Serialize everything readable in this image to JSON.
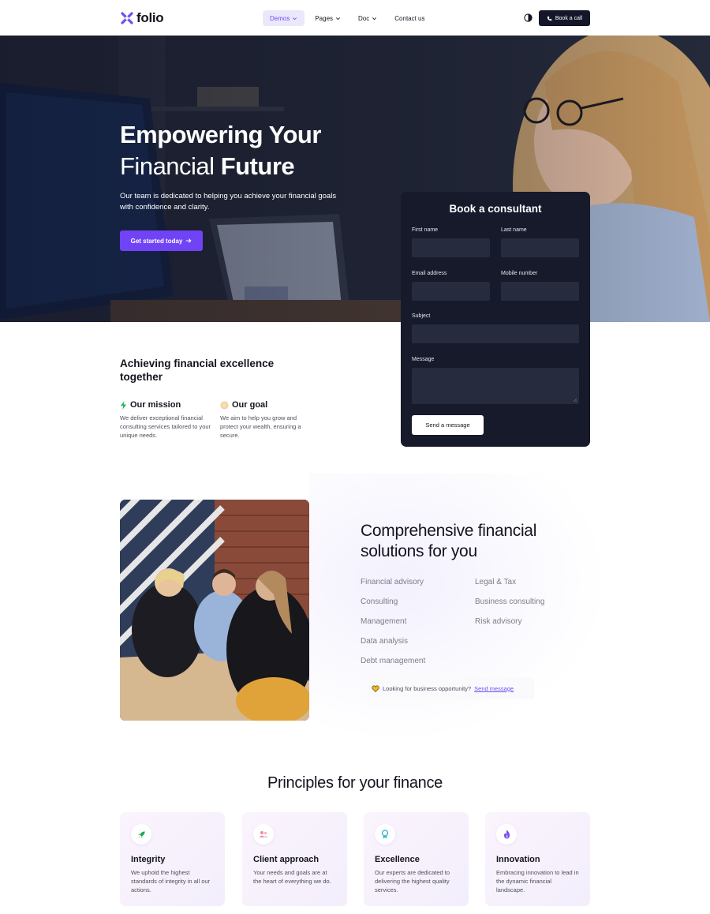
{
  "nav": {
    "brand": "folio",
    "menu": [
      {
        "label": "Demos",
        "active": true,
        "dropdown": true
      },
      {
        "label": "Pages",
        "active": false,
        "dropdown": true
      },
      {
        "label": "Doc",
        "active": false,
        "dropdown": true
      },
      {
        "label": "Contact us",
        "active": false,
        "dropdown": false
      }
    ],
    "cta": "Book a call"
  },
  "hero": {
    "title_line1": "Empowering Your",
    "title_line2_regular": "Financial ",
    "title_line2_bold": "Future",
    "subtitle": "Our team is dedicated to helping you achieve your financial goals with confidence and clarity.",
    "button": "Get started today"
  },
  "form": {
    "title": "Book a consultant",
    "first_name": "First name",
    "last_name": "Last name",
    "email": "Email address",
    "mobile": "Mobile number",
    "subject": "Subject",
    "message": "Message",
    "send": "Send a message"
  },
  "about": {
    "title": "Achieving financial excellence together",
    "mission_title": "Our mission",
    "mission_text": "We deliver exceptional financial consulting services tailored to your unique needs.",
    "goal_title": "Our goal",
    "goal_text": "We aim to help you grow and protect your wealth, ensuring a secure."
  },
  "solutions": {
    "title": "Comprehensive financial solutions for you",
    "col1": [
      "Financial advisory",
      "Consulting",
      "Management",
      "Data analysis",
      "Debt management"
    ],
    "col2": [
      "Legal & Tax",
      "Business consulting",
      "Risk advisory"
    ],
    "opportunity_text": "Looking for business opportunity?",
    "opportunity_link": "Send message"
  },
  "principles": {
    "title": "Principles for your finance",
    "cards": [
      {
        "title": "Integrity",
        "text": "We uphold the highest standards of integrity in all our actions."
      },
      {
        "title": "Client approach",
        "text": "Your needs and goals are at the heart of everything we do."
      },
      {
        "title": "Excellence",
        "text": "Our experts are dedicated to delivering the highest quality services."
      },
      {
        "title": "Innovation",
        "text": "Embracing innovation to lead in the dynamic financial landscape."
      }
    ]
  },
  "colors": {
    "accent": "#7043f5",
    "dark": "#161a2b",
    "menu_active_bg": "#ece8fb"
  }
}
